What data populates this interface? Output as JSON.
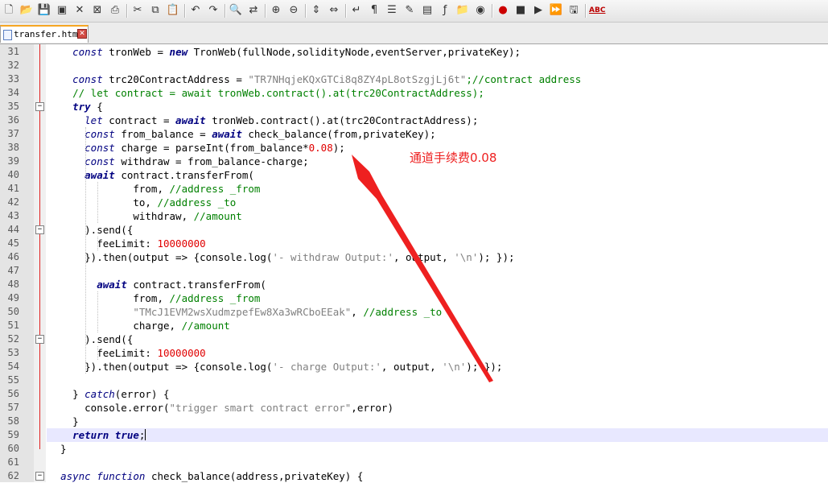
{
  "toolbar": {
    "icons": [
      "new-file-icon",
      "open-file-icon",
      "save-icon",
      "save-all-icon",
      "close-icon",
      "close-all-icon",
      "print-icon",
      "cut-icon",
      "copy-icon",
      "paste-icon",
      "undo-icon",
      "redo-icon",
      "find-icon",
      "replace-icon",
      "zoom-in-icon",
      "zoom-out-icon",
      "sync-vertical-icon",
      "sync-horizontal-icon",
      "word-wrap-icon",
      "show-all-chars-icon",
      "indent-guide-icon",
      "user-language-icon",
      "document-map-icon",
      "function-list-icon",
      "folder-workspace-icon",
      "monitor-icon",
      "record-macro-icon",
      "stop-recording-icon",
      "play-macro-icon",
      "run-macro-multiple-icon",
      "save-macro-icon",
      "spell-check-icon"
    ],
    "spell_check_label": "ABC"
  },
  "tab": {
    "label": "transfer.html",
    "close_symbol": "✕"
  },
  "editor": {
    "active_line": 59,
    "lines": [
      {
        "n": "31",
        "seg": [
          [
            "",
            "    "
          ],
          [
            "kw",
            "const"
          ],
          [
            "",
            " tronWeb = "
          ],
          [
            "kb",
            "new"
          ],
          [
            "",
            " TronWeb(fullNode,solidityNode,eventServer,privateKey);"
          ]
        ]
      },
      {
        "n": "32",
        "seg": []
      },
      {
        "n": "33",
        "seg": [
          [
            "",
            "    "
          ],
          [
            "kw",
            "const"
          ],
          [
            "",
            " trc20ContractAddress = "
          ],
          [
            "str",
            "\"TR7NHqjeKQxGTCi8q8ZY4pL8otSzgjLj6t\""
          ],
          [
            "cm",
            ";//contract address"
          ]
        ]
      },
      {
        "n": "34",
        "seg": [
          [
            "cm",
            "    // let contract = await tronWeb.contract().at(trc20ContractAddress);"
          ]
        ]
      },
      {
        "n": "35",
        "seg": [
          [
            "",
            "    "
          ],
          [
            "kb",
            "try"
          ],
          [
            "",
            " {"
          ]
        ]
      },
      {
        "n": "36",
        "seg": [
          [
            "",
            "      "
          ],
          [
            "kw",
            "let"
          ],
          [
            "",
            " contract = "
          ],
          [
            "kb",
            "await"
          ],
          [
            "",
            " tronWeb.contract().at(trc20ContractAddress);"
          ]
        ]
      },
      {
        "n": "37",
        "seg": [
          [
            "",
            "      "
          ],
          [
            "kw",
            "const"
          ],
          [
            "",
            " from_balance = "
          ],
          [
            "kb",
            "await"
          ],
          [
            "",
            " check_balance(from,privateKey);"
          ]
        ]
      },
      {
        "n": "38",
        "seg": [
          [
            "",
            "      "
          ],
          [
            "kw",
            "const"
          ],
          [
            "",
            " charge = parseInt(from_balance*"
          ],
          [
            "num",
            "0.08"
          ],
          [
            "",
            ");"
          ]
        ]
      },
      {
        "n": "39",
        "seg": [
          [
            "",
            "      "
          ],
          [
            "kw",
            "const"
          ],
          [
            "",
            " withdraw = from_balance-charge;"
          ]
        ]
      },
      {
        "n": "40",
        "seg": [
          [
            "",
            "      "
          ],
          [
            "kb",
            "await"
          ],
          [
            "",
            " contract.transferFrom("
          ]
        ]
      },
      {
        "n": "41",
        "seg": [
          [
            "",
            "              from, "
          ],
          [
            "cm",
            "//address _from"
          ]
        ]
      },
      {
        "n": "42",
        "seg": [
          [
            "",
            "              to, "
          ],
          [
            "cm",
            "//address _to"
          ]
        ]
      },
      {
        "n": "43",
        "seg": [
          [
            "",
            "              withdraw, "
          ],
          [
            "cm",
            "//amount"
          ]
        ]
      },
      {
        "n": "44",
        "seg": [
          [
            "",
            "      ).send({"
          ]
        ]
      },
      {
        "n": "45",
        "seg": [
          [
            "",
            "        feeLimit: "
          ],
          [
            "num",
            "10000000"
          ]
        ]
      },
      {
        "n": "46",
        "seg": [
          [
            "",
            "      }).then(output => {console.log("
          ],
          [
            "str",
            "'- withdraw Output:'"
          ],
          [
            "",
            ", output, "
          ],
          [
            "str",
            "'\\n'"
          ],
          [
            "",
            "); });"
          ]
        ]
      },
      {
        "n": "47",
        "seg": []
      },
      {
        "n": "48",
        "seg": [
          [
            "",
            "        "
          ],
          [
            "kb",
            "await"
          ],
          [
            "",
            " contract.transferFrom("
          ]
        ]
      },
      {
        "n": "49",
        "seg": [
          [
            "",
            "              from, "
          ],
          [
            "cm",
            "//address _from"
          ]
        ]
      },
      {
        "n": "50",
        "seg": [
          [
            "",
            "              "
          ],
          [
            "str",
            "\"TMcJ1EVM2wsXudmzpefEw8Xa3wRCboEEak\""
          ],
          [
            "",
            ", "
          ],
          [
            "cm",
            "//address _to"
          ]
        ]
      },
      {
        "n": "51",
        "seg": [
          [
            "",
            "              charge, "
          ],
          [
            "cm",
            "//amount"
          ]
        ]
      },
      {
        "n": "52",
        "seg": [
          [
            "",
            "      ).send({"
          ]
        ]
      },
      {
        "n": "53",
        "seg": [
          [
            "",
            "        feeLimit: "
          ],
          [
            "num",
            "10000000"
          ]
        ]
      },
      {
        "n": "54",
        "seg": [
          [
            "",
            "      }).then(output => {console.log("
          ],
          [
            "str",
            "'- charge Output:'"
          ],
          [
            "",
            ", output, "
          ],
          [
            "str",
            "'\\n'"
          ],
          [
            "",
            "); });"
          ]
        ]
      },
      {
        "n": "55",
        "seg": []
      },
      {
        "n": "56",
        "seg": [
          [
            "",
            "    } "
          ],
          [
            "kw",
            "catch"
          ],
          [
            "",
            "(error) {"
          ]
        ]
      },
      {
        "n": "57",
        "seg": [
          [
            "",
            "      console.error("
          ],
          [
            "str",
            "\"trigger smart contract error\""
          ],
          [
            "",
            ",error)"
          ]
        ]
      },
      {
        "n": "58",
        "seg": [
          [
            "",
            "    }"
          ]
        ]
      },
      {
        "n": "59",
        "seg": [
          [
            "",
            "    "
          ],
          [
            "kb",
            "return"
          ],
          [
            "",
            " "
          ],
          [
            "kb",
            "true"
          ],
          [
            "",
            ";"
          ]
        ]
      },
      {
        "n": "60",
        "seg": [
          [
            "",
            "  }"
          ]
        ]
      },
      {
        "n": "61",
        "seg": []
      },
      {
        "n": "62",
        "seg": [
          [
            "",
            "  "
          ],
          [
            "kw",
            "async"
          ],
          [
            "",
            " "
          ],
          [
            "kw",
            "function"
          ],
          [
            "",
            " check_balance(address,privateKey) {"
          ]
        ]
      }
    ]
  },
  "annotation": {
    "text": "通道手续费0.08",
    "color": "#ee2020"
  }
}
